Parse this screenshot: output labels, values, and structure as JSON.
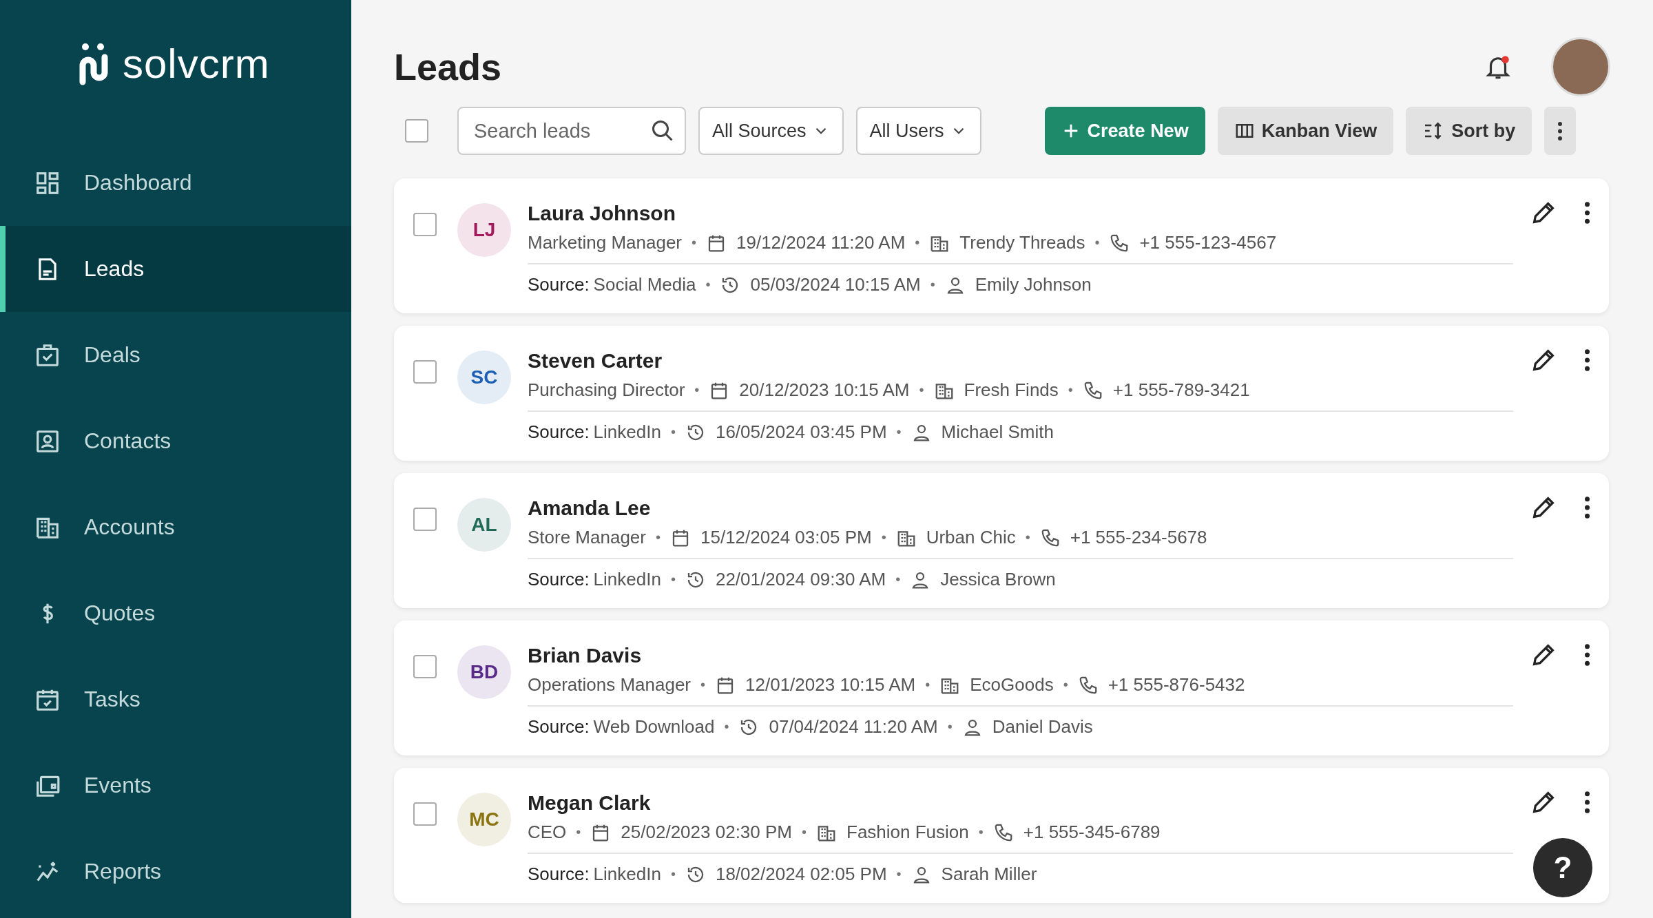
{
  "brand": {
    "name": "solvcrm"
  },
  "sidebar": {
    "items": [
      {
        "label": "Dashboard",
        "selected": false
      },
      {
        "label": "Leads",
        "selected": true
      },
      {
        "label": "Deals",
        "selected": false
      },
      {
        "label": "Contacts",
        "selected": false
      },
      {
        "label": "Accounts",
        "selected": false
      },
      {
        "label": "Quotes",
        "selected": false
      },
      {
        "label": "Tasks",
        "selected": false
      },
      {
        "label": "Events",
        "selected": false
      },
      {
        "label": "Reports",
        "selected": false
      }
    ]
  },
  "header": {
    "title": "Leads",
    "notifications_unread": true
  },
  "toolbar": {
    "select_all_checked": false,
    "search": {
      "placeholder": "Search leads"
    },
    "filters": [
      "All Sources",
      "All Users"
    ],
    "buttons": [
      "Create New",
      "Kanban View",
      "Sort by"
    ]
  },
  "leads": [
    {
      "initials": "LJ",
      "color": "#a3195b",
      "name": "Laura Johnson",
      "title": "Marketing Manager",
      "date": "19/12/2024 11:20 AM",
      "company": "Trendy Threads",
      "phone": "+1 555-123-4567",
      "source_label": "Source:",
      "source": "Social Media",
      "updated": "05/03/2024 10:15 AM",
      "owner": "Emily Johnson",
      "checked": false,
      "separators": [
        "•",
        "•",
        "•"
      ],
      "separators_2": [
        "•",
        "•"
      ]
    },
    {
      "initials": "SC",
      "color": "#1d5fb3",
      "name": "Steven Carter",
      "title": "Purchasing Director",
      "date": "20/12/2023 10:15 AM",
      "company": "Fresh Finds",
      "phone": "+1 555-789-3421",
      "source_label": "Source:",
      "source": "LinkedIn",
      "updated": "16/05/2024 03:45 PM",
      "owner": "Michael Smith",
      "checked": false,
      "separators": [
        "•",
        "•",
        "•"
      ],
      "separators_2": [
        "•",
        "•"
      ]
    },
    {
      "initials": "AL",
      "color": "#1f6b55",
      "name": "Amanda Lee",
      "title": "Store Manager",
      "date": "15/12/2024 03:05 PM",
      "company": "Urban Chic",
      "phone": "+1 555-234-5678",
      "source_label": "Source:",
      "source": "LinkedIn",
      "updated": "22/01/2024 09:30 AM",
      "owner": "Jessica Brown",
      "checked": false,
      "separators": [
        "•",
        "•",
        "•"
      ],
      "separators_2": [
        "•",
        "•"
      ]
    },
    {
      "initials": "BD",
      "color": "#5a2a8a",
      "name": "Brian Davis",
      "title": "Operations Manager",
      "date": "12/01/2023 10:15 AM",
      "company": "EcoGoods",
      "phone": "+1 555-876-5432",
      "source_label": "Source:",
      "source": "Web Download",
      "updated": "07/04/2024 11:20 AM",
      "owner": "Daniel Davis",
      "checked": false,
      "separators": [
        "•",
        "•",
        "•"
      ],
      "separators_2": [
        "•",
        "•"
      ]
    },
    {
      "initials": "MC",
      "color": "#8a7410",
      "name": "Megan Clark",
      "title": "CEO",
      "date": "25/02/2023 02:30 PM",
      "company": "Fashion Fusion",
      "phone": "+1 555-345-6789",
      "source_label": "Source:",
      "source": "LinkedIn",
      "updated": "18/02/2024 02:05 PM",
      "owner": "Sarah Miller",
      "checked": false,
      "separators": [
        "•",
        "•",
        "•"
      ],
      "separators_2": [
        "•",
        "•"
      ]
    }
  ],
  "help": {
    "label": "?"
  }
}
